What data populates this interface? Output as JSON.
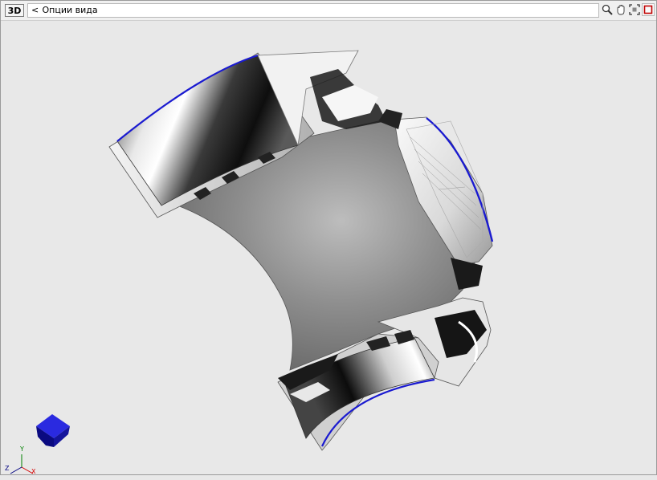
{
  "toolbar": {
    "mode_button": "3D",
    "view_options": {
      "chevron": "<",
      "label": "Опции вида"
    },
    "tools": [
      {
        "icon": "zoom-icon"
      },
      {
        "icon": "pan-hand-icon"
      },
      {
        "icon": "fit-view-icon"
      },
      {
        "icon": "stop-square-icon"
      }
    ]
  },
  "triad": {
    "x_label": "X",
    "y_label": "Y",
    "z_label": "Z",
    "x_color": "#d40000",
    "y_color": "#008000",
    "z_color": "#000080"
  },
  "colors": {
    "accent_stop": "#c00000",
    "edge_blue": "#1a1ad0",
    "cube_blue": "#1010a0"
  }
}
